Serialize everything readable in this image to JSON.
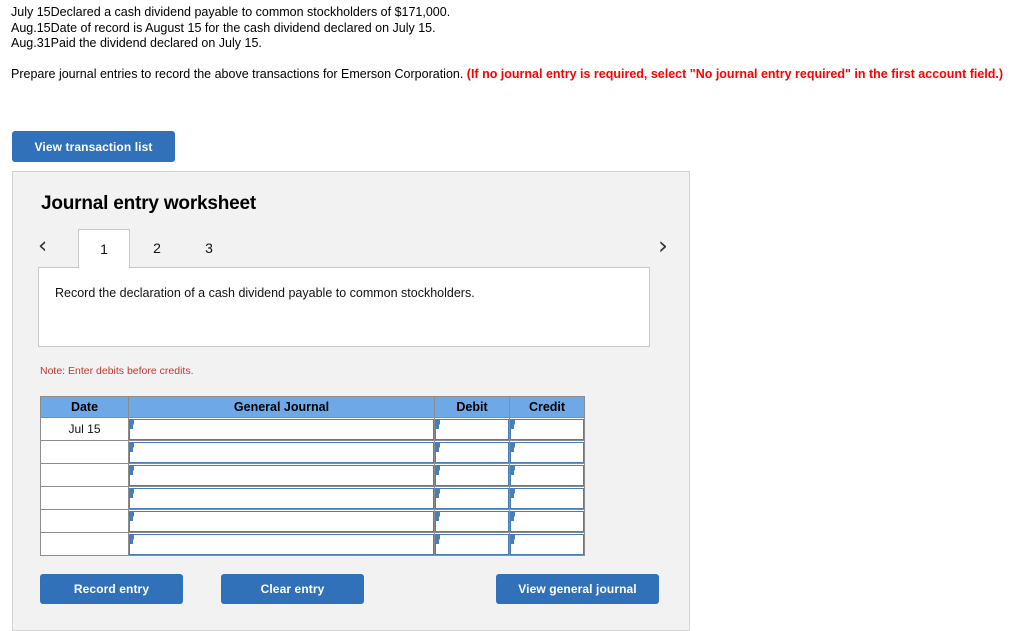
{
  "problem": {
    "transactions": [
      {
        "month": "July",
        "day": "15",
        "description": "Declared a cash dividend payable to common stockholders of $171,000."
      },
      {
        "month": "Aug.",
        "day": "15",
        "description": "Date of record is August 15 for the cash dividend declared on July 15."
      },
      {
        "month": "Aug.",
        "day": "31",
        "description": "Paid the dividend declared on July 15."
      }
    ],
    "instruction_plain": "Prepare journal entries to record the above transactions for Emerson Corporation. ",
    "instruction_red": "(If no journal entry is required, select \"No journal entry required\" in the first account field.)"
  },
  "toolbar": {
    "view_transaction_list_label": "View transaction list"
  },
  "worksheet": {
    "title": "Journal entry worksheet",
    "prev_arrow": "‹",
    "next_arrow": "›",
    "tabs": [
      {
        "label": "1",
        "active": true
      },
      {
        "label": "2",
        "active": false
      },
      {
        "label": "3",
        "active": false
      }
    ],
    "description": "Record the declaration of a cash dividend payable to common stockholders.",
    "note": "Note: Enter debits before credits.",
    "table": {
      "headers": [
        "Date",
        "General Journal",
        "Debit",
        "Credit"
      ],
      "rows": [
        {
          "date": "Jul 15",
          "general_journal": "",
          "debit": "",
          "credit": ""
        },
        {
          "date": "",
          "general_journal": "",
          "debit": "",
          "credit": ""
        },
        {
          "date": "",
          "general_journal": "",
          "debit": "",
          "credit": ""
        },
        {
          "date": "",
          "general_journal": "",
          "debit": "",
          "credit": ""
        },
        {
          "date": "",
          "general_journal": "",
          "debit": "",
          "credit": ""
        },
        {
          "date": "",
          "general_journal": "",
          "debit": "",
          "credit": ""
        }
      ]
    },
    "actions": {
      "record_entry_label": "Record entry",
      "clear_entry_label": "Clear entry",
      "view_general_journal_label": "View general journal"
    }
  },
  "colors": {
    "button_blue": "#3071b9",
    "header_blue": "#6ea8e6",
    "input_border_blue": "#4a7ebb",
    "panel_background": "#f2f2f2",
    "panel_border": "#d3d3d3",
    "red_text": "#ff0000",
    "note_red": "#c0392b"
  }
}
